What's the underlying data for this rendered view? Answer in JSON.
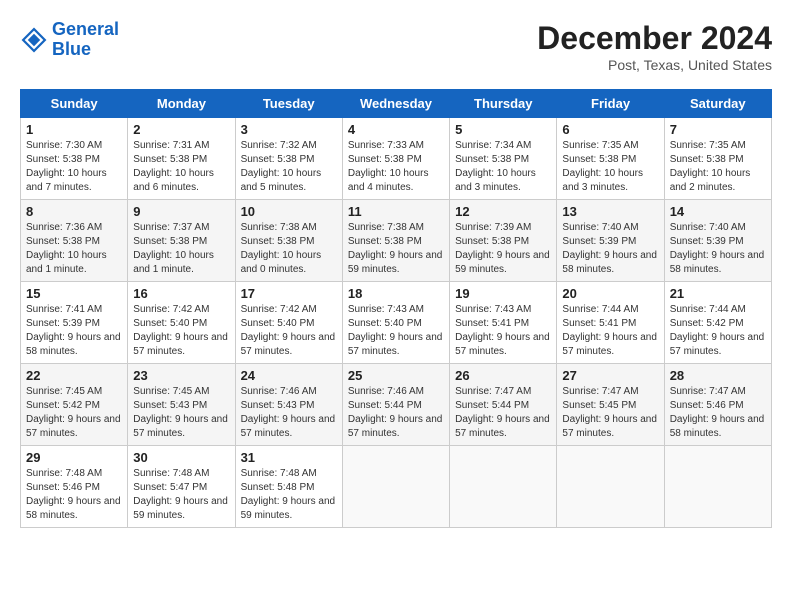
{
  "header": {
    "logo_line1": "General",
    "logo_line2": "Blue",
    "month_title": "December 2024",
    "location": "Post, Texas, United States"
  },
  "days_of_week": [
    "Sunday",
    "Monday",
    "Tuesday",
    "Wednesday",
    "Thursday",
    "Friday",
    "Saturday"
  ],
  "weeks": [
    [
      {
        "day": 1,
        "sunrise": "Sunrise: 7:30 AM",
        "sunset": "Sunset: 5:38 PM",
        "daylight": "Daylight: 10 hours and 7 minutes."
      },
      {
        "day": 2,
        "sunrise": "Sunrise: 7:31 AM",
        "sunset": "Sunset: 5:38 PM",
        "daylight": "Daylight: 10 hours and 6 minutes."
      },
      {
        "day": 3,
        "sunrise": "Sunrise: 7:32 AM",
        "sunset": "Sunset: 5:38 PM",
        "daylight": "Daylight: 10 hours and 5 minutes."
      },
      {
        "day": 4,
        "sunrise": "Sunrise: 7:33 AM",
        "sunset": "Sunset: 5:38 PM",
        "daylight": "Daylight: 10 hours and 4 minutes."
      },
      {
        "day": 5,
        "sunrise": "Sunrise: 7:34 AM",
        "sunset": "Sunset: 5:38 PM",
        "daylight": "Daylight: 10 hours and 3 minutes."
      },
      {
        "day": 6,
        "sunrise": "Sunrise: 7:35 AM",
        "sunset": "Sunset: 5:38 PM",
        "daylight": "Daylight: 10 hours and 3 minutes."
      },
      {
        "day": 7,
        "sunrise": "Sunrise: 7:35 AM",
        "sunset": "Sunset: 5:38 PM",
        "daylight": "Daylight: 10 hours and 2 minutes."
      }
    ],
    [
      {
        "day": 8,
        "sunrise": "Sunrise: 7:36 AM",
        "sunset": "Sunset: 5:38 PM",
        "daylight": "Daylight: 10 hours and 1 minute."
      },
      {
        "day": 9,
        "sunrise": "Sunrise: 7:37 AM",
        "sunset": "Sunset: 5:38 PM",
        "daylight": "Daylight: 10 hours and 1 minute."
      },
      {
        "day": 10,
        "sunrise": "Sunrise: 7:38 AM",
        "sunset": "Sunset: 5:38 PM",
        "daylight": "Daylight: 10 hours and 0 minutes."
      },
      {
        "day": 11,
        "sunrise": "Sunrise: 7:38 AM",
        "sunset": "Sunset: 5:38 PM",
        "daylight": "Daylight: 9 hours and 59 minutes."
      },
      {
        "day": 12,
        "sunrise": "Sunrise: 7:39 AM",
        "sunset": "Sunset: 5:38 PM",
        "daylight": "Daylight: 9 hours and 59 minutes."
      },
      {
        "day": 13,
        "sunrise": "Sunrise: 7:40 AM",
        "sunset": "Sunset: 5:39 PM",
        "daylight": "Daylight: 9 hours and 58 minutes."
      },
      {
        "day": 14,
        "sunrise": "Sunrise: 7:40 AM",
        "sunset": "Sunset: 5:39 PM",
        "daylight": "Daylight: 9 hours and 58 minutes."
      }
    ],
    [
      {
        "day": 15,
        "sunrise": "Sunrise: 7:41 AM",
        "sunset": "Sunset: 5:39 PM",
        "daylight": "Daylight: 9 hours and 58 minutes."
      },
      {
        "day": 16,
        "sunrise": "Sunrise: 7:42 AM",
        "sunset": "Sunset: 5:40 PM",
        "daylight": "Daylight: 9 hours and 57 minutes."
      },
      {
        "day": 17,
        "sunrise": "Sunrise: 7:42 AM",
        "sunset": "Sunset: 5:40 PM",
        "daylight": "Daylight: 9 hours and 57 minutes."
      },
      {
        "day": 18,
        "sunrise": "Sunrise: 7:43 AM",
        "sunset": "Sunset: 5:40 PM",
        "daylight": "Daylight: 9 hours and 57 minutes."
      },
      {
        "day": 19,
        "sunrise": "Sunrise: 7:43 AM",
        "sunset": "Sunset: 5:41 PM",
        "daylight": "Daylight: 9 hours and 57 minutes."
      },
      {
        "day": 20,
        "sunrise": "Sunrise: 7:44 AM",
        "sunset": "Sunset: 5:41 PM",
        "daylight": "Daylight: 9 hours and 57 minutes."
      },
      {
        "day": 21,
        "sunrise": "Sunrise: 7:44 AM",
        "sunset": "Sunset: 5:42 PM",
        "daylight": "Daylight: 9 hours and 57 minutes."
      }
    ],
    [
      {
        "day": 22,
        "sunrise": "Sunrise: 7:45 AM",
        "sunset": "Sunset: 5:42 PM",
        "daylight": "Daylight: 9 hours and 57 minutes."
      },
      {
        "day": 23,
        "sunrise": "Sunrise: 7:45 AM",
        "sunset": "Sunset: 5:43 PM",
        "daylight": "Daylight: 9 hours and 57 minutes."
      },
      {
        "day": 24,
        "sunrise": "Sunrise: 7:46 AM",
        "sunset": "Sunset: 5:43 PM",
        "daylight": "Daylight: 9 hours and 57 minutes."
      },
      {
        "day": 25,
        "sunrise": "Sunrise: 7:46 AM",
        "sunset": "Sunset: 5:44 PM",
        "daylight": "Daylight: 9 hours and 57 minutes."
      },
      {
        "day": 26,
        "sunrise": "Sunrise: 7:47 AM",
        "sunset": "Sunset: 5:44 PM",
        "daylight": "Daylight: 9 hours and 57 minutes."
      },
      {
        "day": 27,
        "sunrise": "Sunrise: 7:47 AM",
        "sunset": "Sunset: 5:45 PM",
        "daylight": "Daylight: 9 hours and 57 minutes."
      },
      {
        "day": 28,
        "sunrise": "Sunrise: 7:47 AM",
        "sunset": "Sunset: 5:46 PM",
        "daylight": "Daylight: 9 hours and 58 minutes."
      }
    ],
    [
      {
        "day": 29,
        "sunrise": "Sunrise: 7:48 AM",
        "sunset": "Sunset: 5:46 PM",
        "daylight": "Daylight: 9 hours and 58 minutes."
      },
      {
        "day": 30,
        "sunrise": "Sunrise: 7:48 AM",
        "sunset": "Sunset: 5:47 PM",
        "daylight": "Daylight: 9 hours and 59 minutes."
      },
      {
        "day": 31,
        "sunrise": "Sunrise: 7:48 AM",
        "sunset": "Sunset: 5:48 PM",
        "daylight": "Daylight: 9 hours and 59 minutes."
      },
      null,
      null,
      null,
      null
    ]
  ]
}
